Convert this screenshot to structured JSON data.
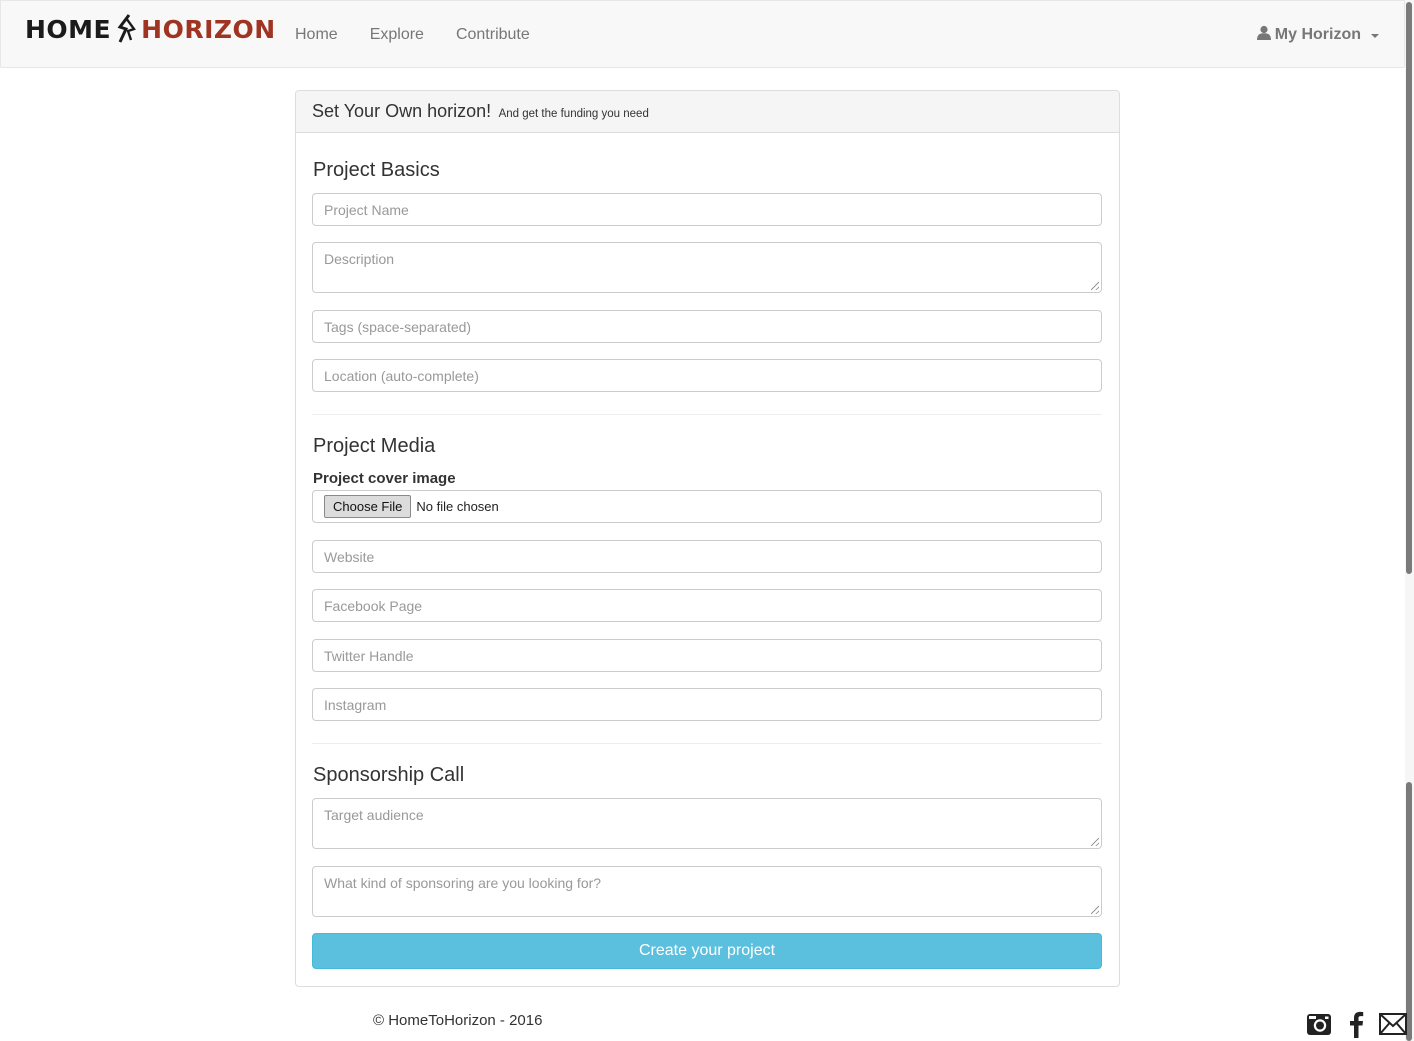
{
  "brand": {
    "part1": "HOME",
    "part2": "HORIZON"
  },
  "nav": {
    "home": "Home",
    "explore": "Explore",
    "contribute": "Contribute",
    "account": "My Horizon"
  },
  "panel": {
    "title": "Set Your Own horizon!",
    "subtitle": "And get the funding you need"
  },
  "basics": {
    "title": "Project Basics",
    "project_name_placeholder": "Project Name",
    "description_placeholder": "Description",
    "tags_placeholder": "Tags (space-separated)",
    "location_placeholder": "Location (auto-complete)"
  },
  "media": {
    "title": "Project Media",
    "cover_label": "Project cover image",
    "choose_file": "Choose File",
    "no_file": "No file chosen",
    "website_placeholder": "Website",
    "facebook_placeholder": "Facebook Page",
    "twitter_placeholder": "Twitter Handle",
    "instagram_placeholder": "Instagram"
  },
  "sponsorship": {
    "title": "Sponsorship Call",
    "audience_placeholder": "Target audience",
    "kind_placeholder": "What kind of sponsoring are you looking for?"
  },
  "submit_label": "Create your project",
  "footer": {
    "copyright": "© HomeToHorizon - 2016"
  },
  "icons": {
    "account": "user-icon",
    "instagram": "instagram-icon",
    "facebook": "facebook-icon",
    "mail": "mail-icon"
  },
  "colors": {
    "brand_dark": "#1b1b1b",
    "brand_red": "#a03423",
    "submit": "#5bc0de"
  }
}
